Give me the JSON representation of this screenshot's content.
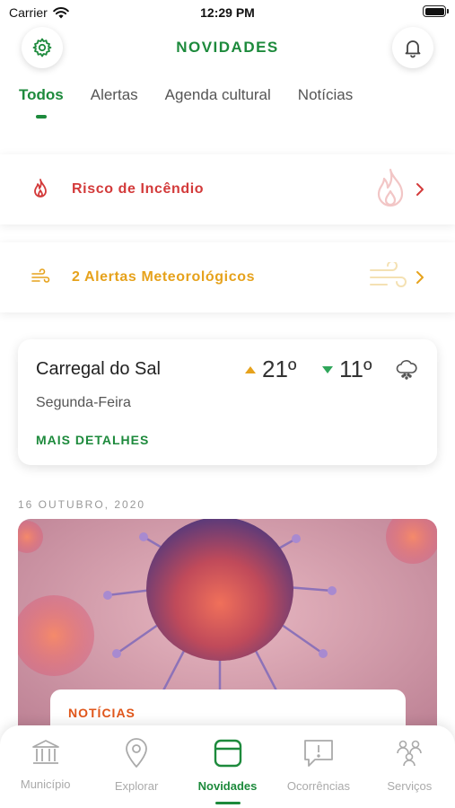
{
  "status_bar": {
    "carrier": "Carrier",
    "time": "12:29 PM"
  },
  "header": {
    "title": "NOVIDADES",
    "settings_icon": "gear-icon",
    "notifications_icon": "bell-icon"
  },
  "tabs": [
    {
      "label": "Todos",
      "active": true
    },
    {
      "label": "Alertas",
      "active": false
    },
    {
      "label": "Agenda cultural",
      "active": false
    },
    {
      "label": "Notícias",
      "active": false
    }
  ],
  "alerts": {
    "fire": {
      "label": "Risco de Incêndio",
      "icon": "flame-icon",
      "color": "#d33a3a"
    },
    "weather": {
      "label": "2 Alertas Meteorológicos",
      "icon": "wind-icon",
      "color": "#e6a21c"
    }
  },
  "weather": {
    "city": "Carregal do Sal",
    "day": "Segunda-Feira",
    "max": "21º",
    "min": "11º",
    "condition_icon": "cloud-rain-icon",
    "more_label": "MAIS DETALHES"
  },
  "feed": {
    "date": "16 OUTUBRO, 2020",
    "news_card": {
      "category": "NOTÍCIAS",
      "image_icon": "virus-illustration"
    }
  },
  "bottom_nav": [
    {
      "label": "Município",
      "icon": "building-icon",
      "active": false
    },
    {
      "label": "Explorar",
      "icon": "map-pin-icon",
      "active": false
    },
    {
      "label": "Novidades",
      "icon": "news-icon",
      "active": true
    },
    {
      "label": "Ocorrências",
      "icon": "alert-message-icon",
      "active": false
    },
    {
      "label": "Serviços",
      "icon": "services-icon",
      "active": false
    }
  ],
  "colors": {
    "brand_green": "#1d8a3c",
    "fire_red": "#d33a3a",
    "warning_amber": "#e6a21c",
    "news_orange": "#e0561a"
  }
}
